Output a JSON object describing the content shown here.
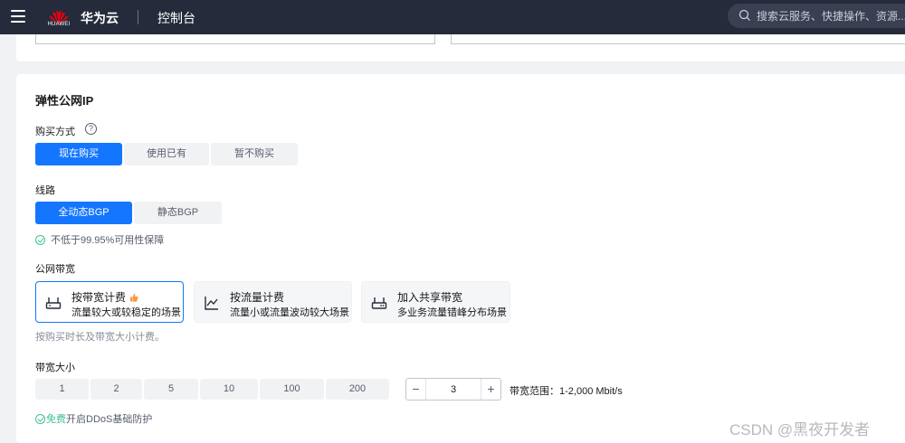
{
  "header": {
    "brand": "华为云",
    "logo_text": "HUAWEI",
    "console": "控制台",
    "search_placeholder": "搜索云服务、快捷操作、资源..."
  },
  "section": {
    "title": "弹性公网IP",
    "purchase": {
      "label": "购买方式",
      "options": [
        "现在购买",
        "使用已有",
        "暂不购买"
      ],
      "selected": "现在购买"
    },
    "line": {
      "label": "线路",
      "options": [
        "全动态BGP",
        "静态BGP"
      ],
      "selected": "全动态BGP",
      "note": "不低于99.95%可用性保障"
    },
    "bandwidth": {
      "label": "公网带宽",
      "options": [
        {
          "title": "按带宽计费",
          "desc": "流量较大或较稳定的场景",
          "icon": "router-icon"
        },
        {
          "title": "按流量计费",
          "desc": "流量小或流量波动较大场景",
          "icon": "line-chart-icon"
        },
        {
          "title": "加入共享带宽",
          "desc": "多业务流量错峰分布场景",
          "icon": "shared-router-icon"
        }
      ],
      "selected": "按带宽计费",
      "hint": "按购买时长及带宽大小计费。"
    },
    "size": {
      "label": "带宽大小",
      "options": [
        "1",
        "2",
        "5",
        "10",
        "100",
        "200"
      ],
      "value": "3",
      "range": "带宽范围：1-2,000 Mbit/s"
    },
    "ddos": {
      "free": "免费",
      "text": "开启DDoS基础防护"
    }
  },
  "watermark": "CSDN @黑夜开发者",
  "colors": {
    "accent": "#1476ff",
    "topbar": "#252b3a",
    "success": "#3ec28f"
  }
}
